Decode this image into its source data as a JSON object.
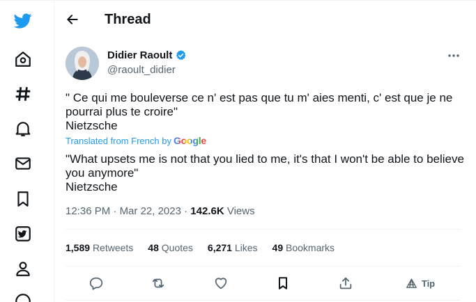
{
  "header": {
    "title": "Thread"
  },
  "author": {
    "name": "Didier Raoult",
    "handle": "@raoult_didier"
  },
  "tweet": {
    "original_text": "\" Ce qui me bouleverse ce n' est pas que tu m' aies menti, c' est que je ne pourrai plus te croire\"\nNietzsche",
    "translated_label": "Translated from French by",
    "translator": "Google",
    "translated_text": "\"What upsets me is not that you lied to me, it's that I won't be able to believe you anymore\"\nNietzsche",
    "time": "12:36 PM",
    "date": "Mar 22, 2023",
    "views_count": "142.6K",
    "views_label": "Views"
  },
  "stats": [
    {
      "count": "1,589",
      "label": "Retweets"
    },
    {
      "count": "48",
      "label": "Quotes"
    },
    {
      "count": "6,271",
      "label": "Likes"
    },
    {
      "count": "49",
      "label": "Bookmarks"
    }
  ],
  "actions": {
    "tip_label": "Tip"
  },
  "colors": {
    "accent": "#1d9bf0",
    "text": "#0f1419",
    "muted": "#536471",
    "border": "#eff3f4"
  },
  "nav_icons": [
    "twitter-logo-icon",
    "home-icon",
    "explore-hashtag-icon",
    "notifications-bell-icon",
    "messages-mail-icon",
    "bookmarks-icon",
    "twitter-blue-icon",
    "profile-icon",
    "more-circle-icon"
  ]
}
